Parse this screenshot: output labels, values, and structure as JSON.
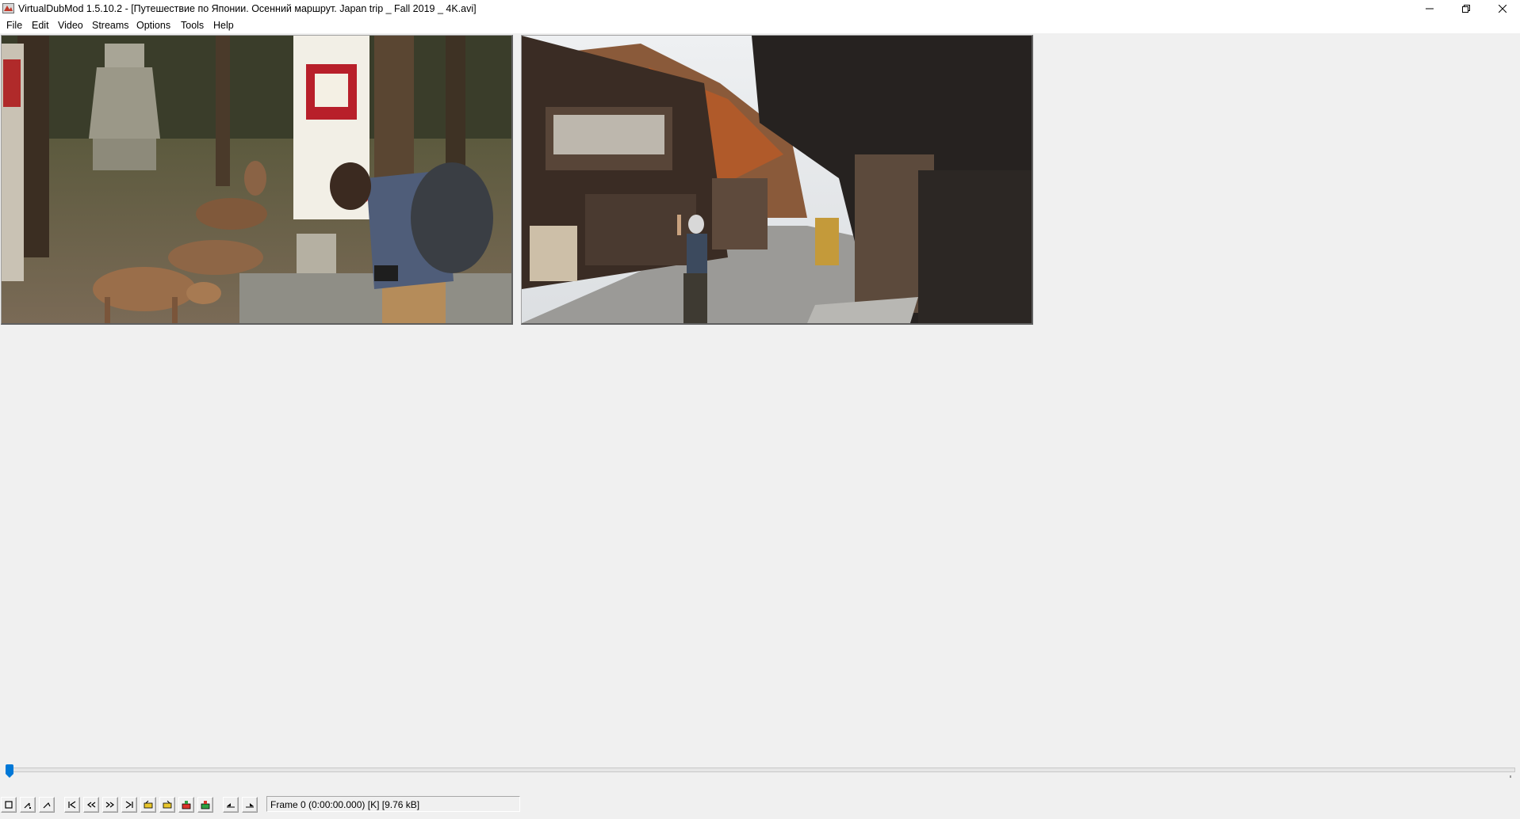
{
  "window": {
    "title": "VirtualDubMod 1.5.10.2 - [Путешествие по Японии. Осенний маршрут. Japan trip _ Fall 2019 _ 4K.avi]",
    "controls": [
      "minimize-icon",
      "restore-icon",
      "close-icon"
    ]
  },
  "menu": {
    "items": [
      {
        "label": "File"
      },
      {
        "label": "Edit"
      },
      {
        "label": "Video"
      },
      {
        "label": "Streams"
      },
      {
        "label": "Options"
      },
      {
        "label": "Tools"
      },
      {
        "label": "Help"
      }
    ]
  },
  "panes": {
    "input": {
      "content": "video-frame-input"
    },
    "output": {
      "content": "video-frame-output"
    }
  },
  "timeline": {
    "position_fraction": 0.0
  },
  "toolbar": {
    "buttons": [
      {
        "name": "stop-icon"
      },
      {
        "name": "play-input-icon"
      },
      {
        "name": "play-output-icon"
      },
      {
        "name": "go-start-icon"
      },
      {
        "name": "prev-frame-icon"
      },
      {
        "name": "next-frame-icon"
      },
      {
        "name": "go-end-icon"
      },
      {
        "name": "prev-keyframe-icon"
      },
      {
        "name": "next-keyframe-icon"
      },
      {
        "name": "prev-scene-icon"
      },
      {
        "name": "next-scene-icon"
      },
      {
        "name": "mark-in-icon"
      },
      {
        "name": "mark-out-icon"
      }
    ],
    "status": "Frame 0 (0:00:00.000) [K] [9.76 kB]"
  },
  "colors": {
    "background": "#f0f0f0",
    "titlebar": "#ffffff",
    "accent": "#0078d7"
  }
}
